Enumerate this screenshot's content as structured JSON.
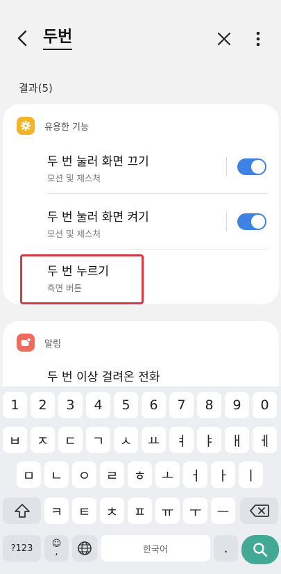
{
  "header": {
    "search_query": "두번",
    "back_icon": "arrow-back-icon",
    "close_icon": "close-icon",
    "more_icon": "more-vert-icon"
  },
  "results": {
    "count_label": "결과(5)"
  },
  "sections": [
    {
      "title": "유용한 기능",
      "icon": "gear-icon",
      "icon_color": "#f4b427",
      "items": [
        {
          "title": "두 번 눌러 화면 끄기",
          "subtitle": "모션 및 제스처",
          "toggle_on": true
        },
        {
          "title": "두 번 눌러 화면 켜기",
          "subtitle": "모션 및 제스처",
          "toggle_on": true
        },
        {
          "title": "두 번 누르기",
          "subtitle": "측면 버튼",
          "highlighted": true
        }
      ]
    },
    {
      "title": "알림",
      "icon": "notification-icon",
      "icon_color": "#f06b5d",
      "items": [
        {
          "title": "두 번 이상 걸려온 전화"
        }
      ]
    }
  ],
  "keyboard": {
    "number_row": [
      "1",
      "2",
      "3",
      "4",
      "5",
      "6",
      "7",
      "8",
      "9",
      "0"
    ],
    "row1": [
      "ㅂ",
      "ㅈ",
      "ㄷ",
      "ㄱ",
      "ㅅ",
      "ㅛ",
      "ㅕ",
      "ㅑ",
      "ㅐ",
      "ㅔ"
    ],
    "row2": [
      "ㅁ",
      "ㄴ",
      "ㅇ",
      "ㄹ",
      "ㅎ",
      "ㅗ",
      "ㅓ",
      "ㅏ",
      "ㅣ"
    ],
    "row3": [
      "ㅋ",
      "ㅌ",
      "ㅊ",
      "ㅍ",
      "ㅠ",
      "ㅜ",
      "ㅡ"
    ],
    "symbols_label": "?123",
    "emoji_top": "☺",
    "emoji_bottom": ",",
    "space_label": "한국어",
    "period_label": ".",
    "accent_color": "#42aa94"
  }
}
